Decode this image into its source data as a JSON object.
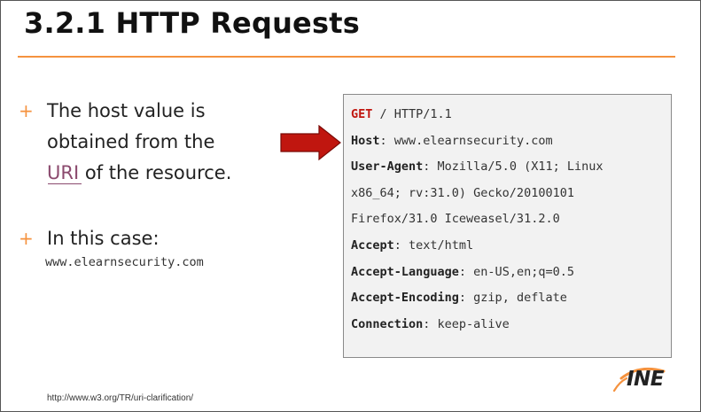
{
  "slide": {
    "title": "3.2.1 HTTP Requests",
    "accent_color": "#f5923e",
    "bullets": [
      {
        "marker": "+",
        "line1": "The host value is",
        "line2": "obtained from the",
        "uri_text": "URI",
        "line3_rest": " of the resource."
      },
      {
        "marker": "+",
        "line1": "In this case:",
        "host_value": "www.elearnsecurity.com"
      }
    ],
    "arrow_icon": "right-arrow-icon",
    "arrow_color": "#c0160f",
    "request": {
      "method": "GET",
      "request_line_rest": " / HTTP/1.1",
      "headers": [
        {
          "name": "Host",
          "value": ": www.elearnsecurity.com"
        },
        {
          "name": "User-Agent",
          "value": ": Mozilla/5.0 (X11; Linux"
        },
        {
          "name": "",
          "value": "x86_64; rv:31.0) Gecko/20100101"
        },
        {
          "name": "",
          "value": "Firefox/31.0 Iceweasel/31.2.0"
        },
        {
          "name": "Accept",
          "value": ": text/html"
        },
        {
          "name": "Accept-Language",
          "value": ": en-US,en;q=0.5"
        },
        {
          "name": "Accept-Encoding",
          "value": ": gzip, deflate"
        },
        {
          "name": "Connection",
          "value": ": keep-alive"
        }
      ]
    },
    "footer_link": "http://www.w3.org/TR/uri-clarification/",
    "logo": {
      "text": "INE",
      "icon": "ine-swoosh-icon"
    }
  }
}
